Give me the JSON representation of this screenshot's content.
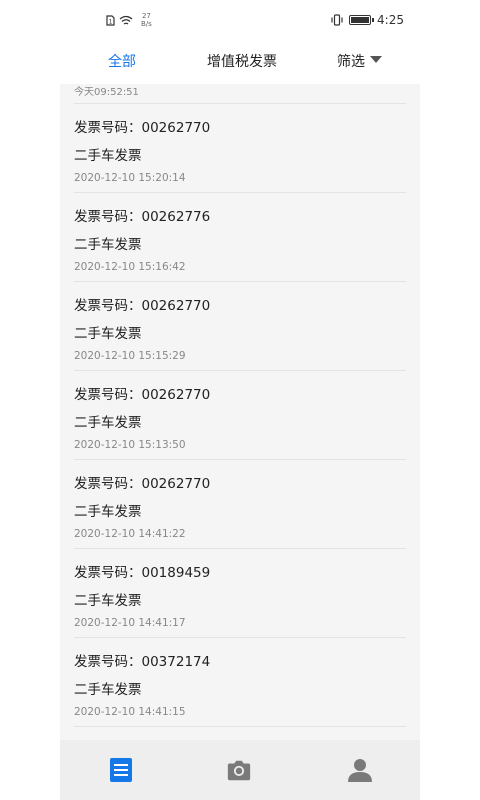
{
  "status_bar": {
    "net_speed_value": "27",
    "net_speed_unit": "B/s",
    "time": "4:25"
  },
  "tabs": {
    "all": "全部",
    "vat": "增值税发票",
    "filter": "筛选"
  },
  "list": {
    "partial_time": "今天09:52:51",
    "items": [
      {
        "number": "发票号码：00262770",
        "type": "二手车发票",
        "time": "2020-12-10 15:20:14"
      },
      {
        "number": "发票号码：00262776",
        "type": "二手车发票",
        "time": "2020-12-10 15:16:42"
      },
      {
        "number": "发票号码：00262770",
        "type": "二手车发票",
        "time": "2020-12-10 15:15:29"
      },
      {
        "number": "发票号码：00262770",
        "type": "二手车发票",
        "time": "2020-12-10 15:13:50"
      },
      {
        "number": "发票号码：00262770",
        "type": "二手车发票",
        "time": "2020-12-10 14:41:22"
      },
      {
        "number": "发票号码：00189459",
        "type": "二手车发票",
        "time": "2020-12-10 14:41:17"
      },
      {
        "number": "发票号码：00372174",
        "type": "二手车发票",
        "time": "2020-12-10 14:41:15"
      }
    ]
  },
  "bottom_nav": {
    "items": [
      "list-icon",
      "camera-icon",
      "user-icon"
    ]
  },
  "colors": {
    "accent": "#1677e8",
    "list_bg": "#f5f5f5",
    "nav_bg": "#eeeeee",
    "icon_gray": "#7a7a7a"
  }
}
